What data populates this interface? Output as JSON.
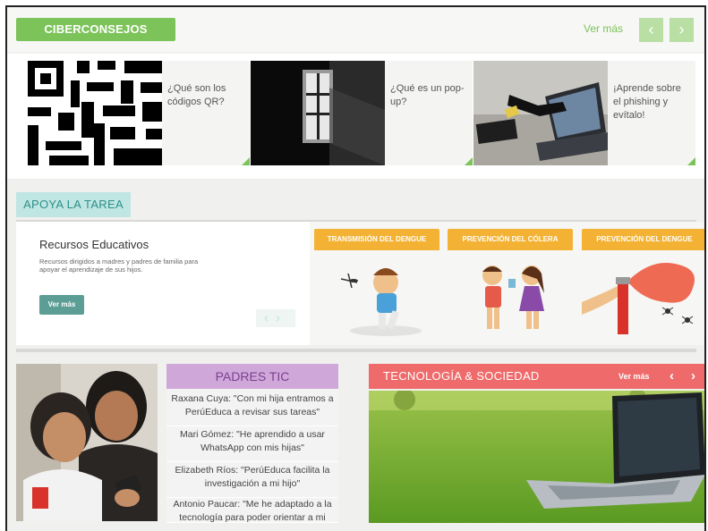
{
  "ciberconsejos": {
    "title": "CIBERCONSEJOS",
    "ver_mas": "Ver más",
    "prev_icon": "chevron-left-icon",
    "next_icon": "chevron-right-icon",
    "items": [
      {
        "caption": "¿Qué son los códigos QR?"
      },
      {
        "caption": "¿Qué es un pop-up?"
      },
      {
        "caption": "¡Aprende sobre el phishing y evítalo!"
      }
    ]
  },
  "apoya": {
    "title": "APOYA LA TAREA",
    "recursos_title": "Recursos Educativos",
    "recursos_desc": "Recursos dirigidos a madres y padres de familia para apoyar el aprendizaje de sus hijos.",
    "ver_mas": "Ver más",
    "prev_icon": "chevron-left-icon",
    "next_icon": "chevron-right-icon",
    "cards": [
      {
        "title": "TRANSMISIÓN DEL DENGUE"
      },
      {
        "title": "PREVENCIÓN DEL CÓLERA"
      },
      {
        "title": "PREVENCIÓN DEL DENGUE"
      }
    ]
  },
  "padres_tic": {
    "title": "PADRES TIC",
    "items": [
      {
        "text": "Raxana Cuya: \"Con mi hija entramos a PerúEduca a revisar sus tareas\""
      },
      {
        "text": "Mari Gómez: \"He aprendido a usar WhatsApp con mis hijas\""
      },
      {
        "text": "Elizabeth Ríos: \"PerúEduca facilita la investigación a mi hijo\""
      },
      {
        "text": "Antonio Paucar: \"Me he adaptado a la tecnología para poder orientar a mi"
      }
    ]
  },
  "tecnologia": {
    "title": "TECNOLOGÍA & SOCIEDAD",
    "ver_mas": "Ver más",
    "prev_icon": "chevron-left-icon",
    "next_icon": "chevron-right-icon"
  },
  "colors": {
    "green": "#7cc35a",
    "teal": "#5c9e95",
    "orange": "#f3b233",
    "purple": "#cfa8d9",
    "red": "#ef6b6b"
  }
}
